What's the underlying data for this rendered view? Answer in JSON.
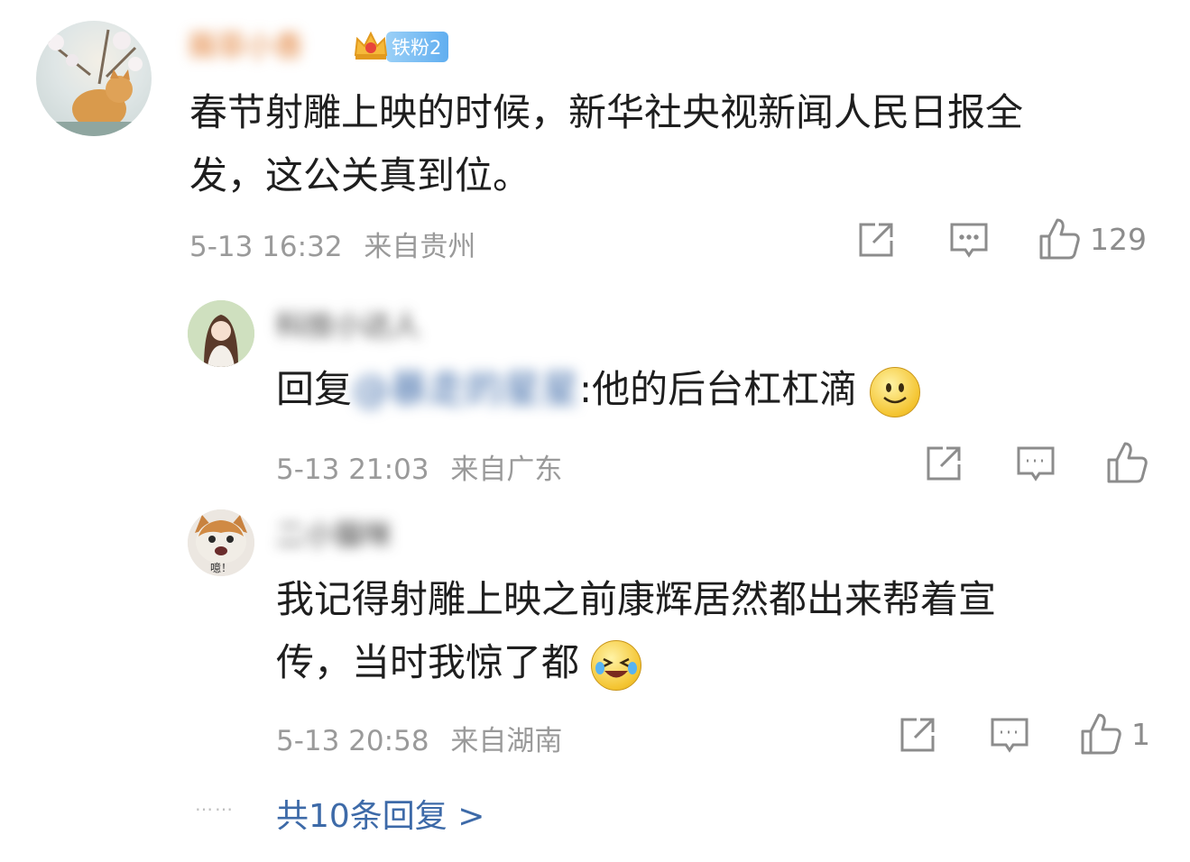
{
  "comment": {
    "username": "薇菲小香",
    "badge": "铁粉2",
    "text_line1": "春节射雕上映的时候，新华社央视新闻人民日报全",
    "text_line2": "发，这公关真到位。",
    "time": "5-13 16:32",
    "location": "来自贵州",
    "likes": "129"
  },
  "replies": [
    {
      "username": "科技小达人",
      "prefix": "回复",
      "mention": "@暴走的星星",
      "text": ":他的后台杠杠滴",
      "emoji": "smile-emoji",
      "time": "5-13 21:03",
      "location": "来自广东",
      "likes": ""
    },
    {
      "username": "二小猫咪",
      "avatar_label": "噫！",
      "text_line1": "我记得射雕上映之前康辉居然都出来帮着宣",
      "text_line2": "传，当时我惊了都",
      "emoji": "laugh-cry-emoji",
      "time": "5-13 20:58",
      "location": "来自湖南",
      "likes": "1"
    }
  ],
  "footer": {
    "dots": "……",
    "more_replies": "共10条回复 >"
  },
  "colors": {
    "username": "#e07a2e",
    "link": "#3d6aa8",
    "meta": "#9a9a9a"
  }
}
